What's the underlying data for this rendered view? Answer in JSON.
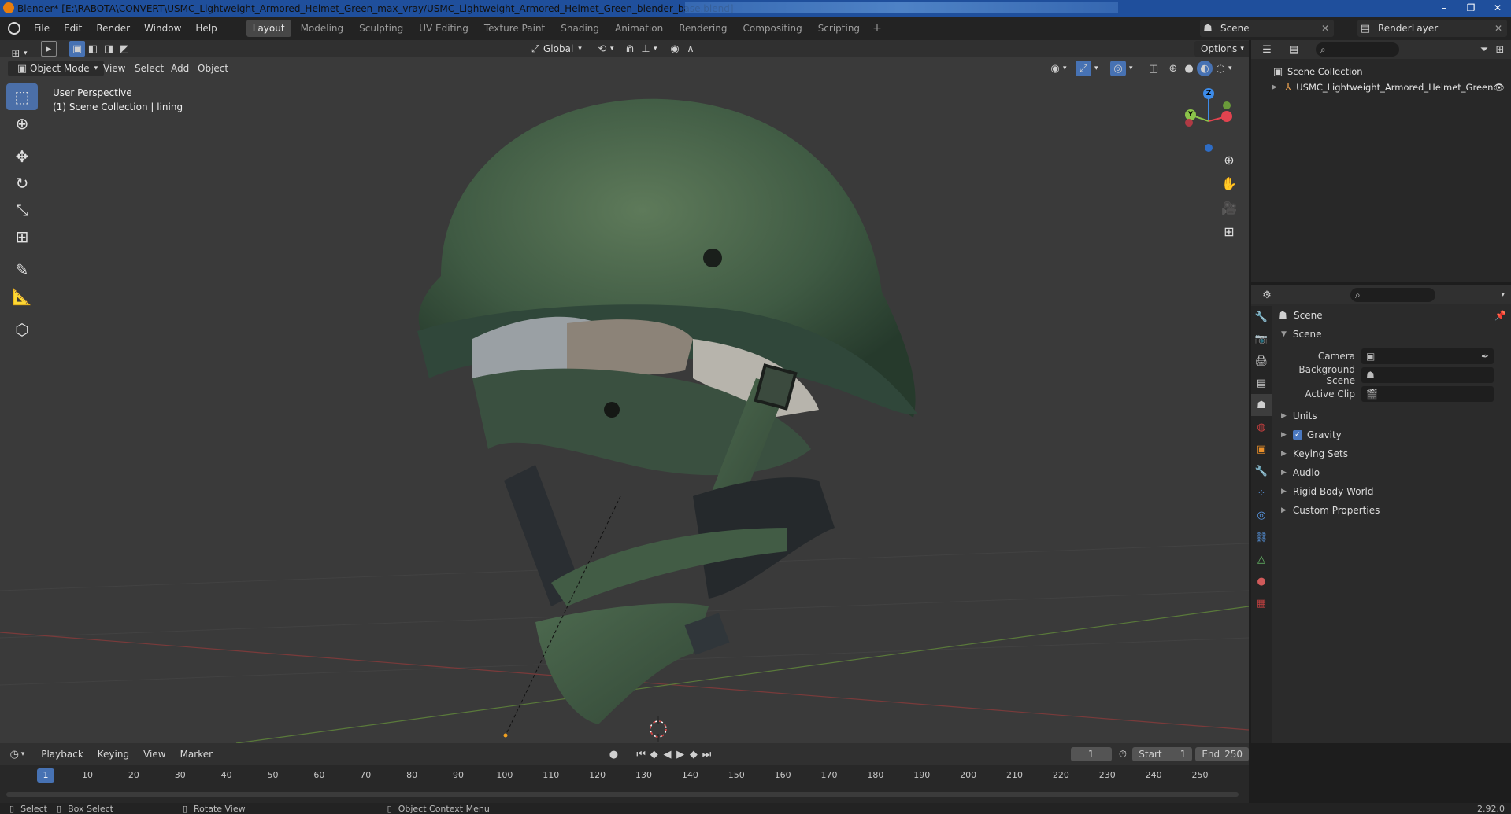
{
  "window": {
    "title": "Blender* [E:\\RABOTA\\CONVERT\\USMC_Lightweight_Armored_Helmet_Green_max_vray/USMC_Lightweight_Armored_Helmet_Green_blender_base.blend]",
    "controls": [
      "–",
      "❐",
      "✕"
    ]
  },
  "menubar": {
    "menus": [
      "File",
      "Edit",
      "Render",
      "Window",
      "Help"
    ],
    "workspaces": [
      "Layout",
      "Modeling",
      "Sculpting",
      "UV Editing",
      "Texture Paint",
      "Shading",
      "Animation",
      "Rendering",
      "Compositing",
      "Scripting"
    ],
    "active_workspace": "Layout",
    "scene_name": "Scene",
    "view_layer": "RenderLayer"
  },
  "viewport": {
    "mode": "Object Mode",
    "menus": [
      "View",
      "Select",
      "Add",
      "Object"
    ],
    "orientation": "Global",
    "options_label": "Options",
    "info_line1": "User Perspective",
    "info_line2": "(1) Scene Collection | lining",
    "gizmo": {
      "z": "Z",
      "y": "Y"
    },
    "axis_colors": {
      "x": "#e2434f",
      "y": "#8bc34a",
      "z": "#3d8be8"
    }
  },
  "outliner": {
    "root": "Scene Collection",
    "items": [
      "USMC_Lightweight_Armored_Helmet_Green"
    ]
  },
  "properties": {
    "header": "Scene",
    "section": "Scene",
    "fields": [
      {
        "label": "Camera",
        "value": ""
      },
      {
        "label": "Background Scene",
        "value": ""
      },
      {
        "label": "Active Clip",
        "value": ""
      }
    ],
    "panels": [
      "Units",
      "Gravity",
      "Keying Sets",
      "Audio",
      "Rigid Body World",
      "Custom Properties"
    ],
    "gravity_checked": true
  },
  "timeline": {
    "menus": [
      "Playback",
      "Keying",
      "View",
      "Marker"
    ],
    "current_frame": "1",
    "start_label": "Start",
    "start": "1",
    "end_label": "End",
    "end": "250",
    "ticks": [
      "1",
      "10",
      "20",
      "30",
      "40",
      "50",
      "60",
      "70",
      "80",
      "90",
      "100",
      "110",
      "120",
      "130",
      "140",
      "150",
      "160",
      "170",
      "180",
      "190",
      "200",
      "210",
      "220",
      "230",
      "240",
      "250"
    ]
  },
  "statusbar": {
    "items": [
      "Select",
      "Box Select",
      "Rotate View",
      "Object Context Menu"
    ],
    "version": "2.92.0"
  }
}
